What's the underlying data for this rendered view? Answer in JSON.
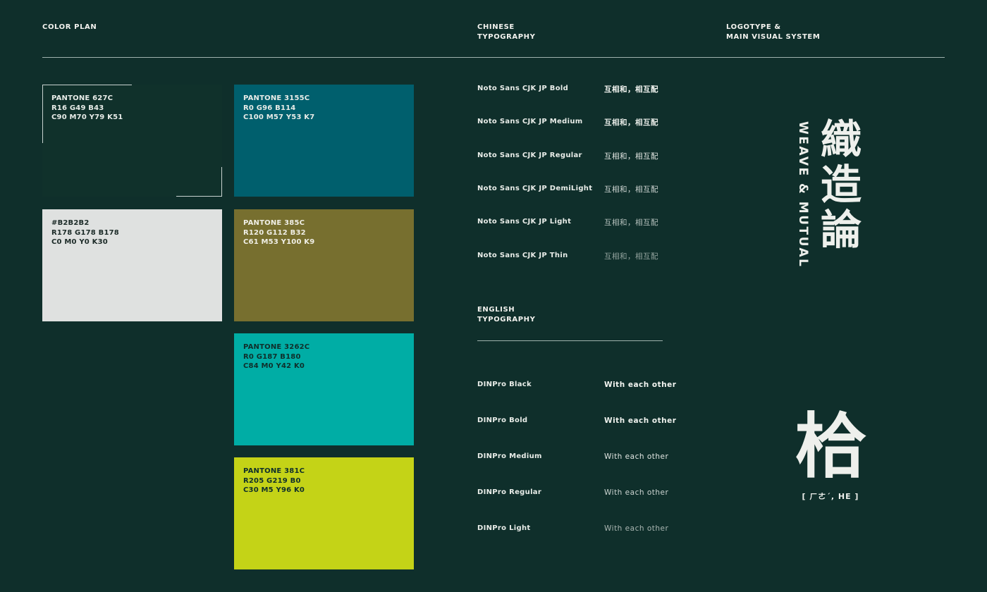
{
  "headers": {
    "color_plan": "COLOR PLAN",
    "chinese_typography": "CHINESE\nTYPOGRAPHY",
    "logotype": "LOGOTYPE &\nMAIN VISUAL SYSTEM",
    "english_typography": "ENGLISH\nTYPOGRAPHY"
  },
  "swatches": [
    {
      "label": "PANTONE 627C\nR16 G49 B43\nC90 M70 Y79 K51",
      "color": "#10312b",
      "text_color": "#e8ece8"
    },
    {
      "label": "PANTONE 3155C\nR0 G96 B114\nC100 M57 Y53 K7",
      "color": "#005f6d",
      "text_color": "#e8ece8"
    },
    {
      "label": "#B2B2B2\nR178 G178 B178\nC0 M0 Y0 K30",
      "color": "#dfe1e0",
      "text_color": "#1b2a27"
    },
    {
      "label": "PANTONE 385C\nR120 G112 B32\nC61 M53 Y100 K9",
      "color": "#776f2f",
      "text_color": "#f0efe6"
    },
    {
      "label": "PANTONE 3262C\nR0 G187 B180\nC84 M0 Y42 K0",
      "color": "#00ada5",
      "text_color": "#0f2f2b"
    },
    {
      "label": "PANTONE 381C\nR205 G219 B0\nC30 M5 Y96 K0",
      "color": "#c4d317",
      "text_color": "#0f2f2b"
    }
  ],
  "chinese_fonts": [
    {
      "name": "Noto Sans CJK JP Bold",
      "sample": "互相和，相互配"
    },
    {
      "name": "Noto Sans CJK JP Medium",
      "sample": "互相和，相互配"
    },
    {
      "name": "Noto Sans CJK JP Regular",
      "sample": "互相和，相互配"
    },
    {
      "name": "Noto Sans CJK JP DemiLight",
      "sample": "互相和，相互配"
    },
    {
      "name": "Noto Sans CJK JP Light",
      "sample": "互相和，相互配"
    },
    {
      "name": "Noto Sans CJK JP Thin",
      "sample": "互相和，相互配"
    }
  ],
  "english_fonts": [
    {
      "name": "DINPro Black",
      "sample": "With each other"
    },
    {
      "name": "DINPro Bold",
      "sample": "With each other"
    },
    {
      "name": "DINPro Medium",
      "sample": "With each other"
    },
    {
      "name": "DINPro Regular",
      "sample": "With each other"
    },
    {
      "name": "DINPro Light",
      "sample": "With each other"
    }
  ],
  "logo": {
    "chinese_title": "織造論",
    "english_title": "WEAVE & MUTUAL",
    "main_char": "㭘",
    "pronunciation": "[ ㄏㄜˊ, HE ]"
  }
}
